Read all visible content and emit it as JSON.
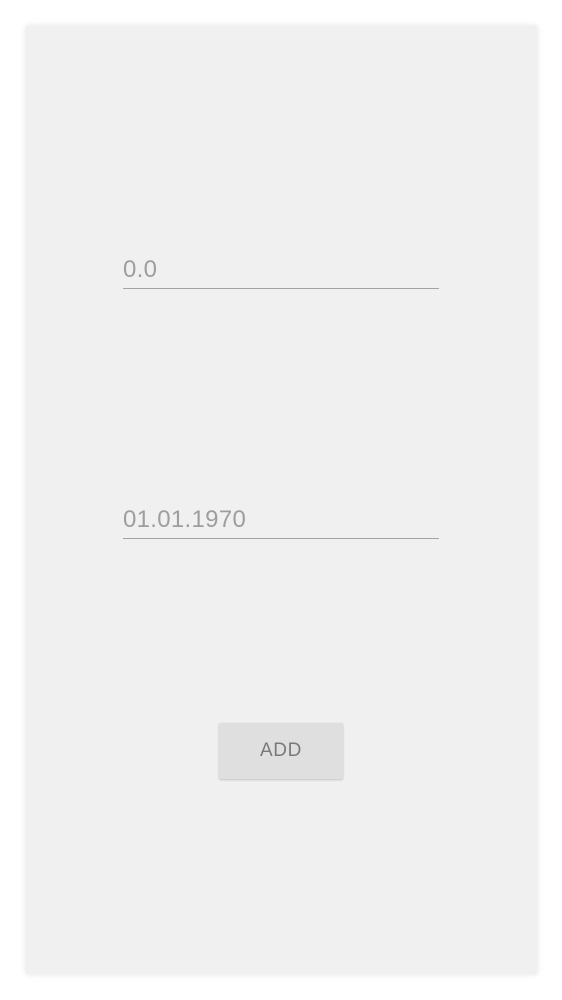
{
  "form": {
    "amount_value": "0.0",
    "date_value": "01.01.1970",
    "add_label": "ADD"
  },
  "colors": {
    "dialog_background": "#f0f0f0",
    "input_text": "#9e9e9e",
    "input_underline": "#a3a3a3",
    "button_background": "#dedfde",
    "button_text": "#7a7a7a"
  }
}
